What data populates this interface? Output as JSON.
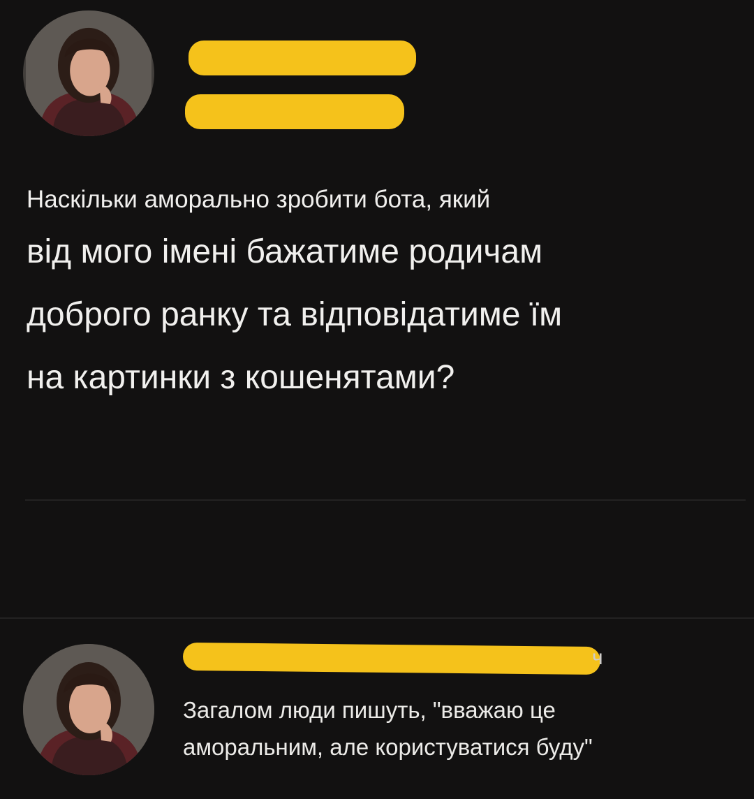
{
  "post": {
    "lines": [
      "Наскільки аморально зробити бота, який",
      "від мого імені бажатиме родичам",
      "доброго ранку та відповідатиме їм",
      "на картинки з кошенятами?"
    ]
  },
  "reply": {
    "time": "ч",
    "lines": [
      "Загалом люди пишуть, \"вважаю це",
      "аморальним, але користуватися буду\""
    ]
  },
  "colors": {
    "background": "#121111",
    "redaction": "#f5c21b",
    "text": "#f1f0ee"
  }
}
